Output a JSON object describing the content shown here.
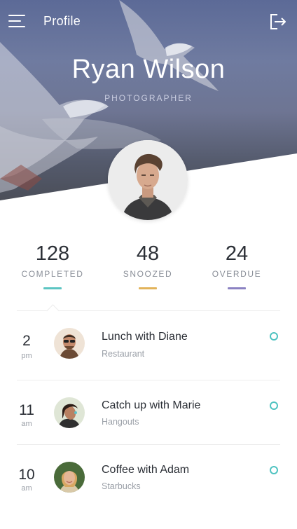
{
  "header": {
    "screen_title": "Profile",
    "icons": {
      "menu": "menu-icon",
      "logout": "logout-icon"
    }
  },
  "user": {
    "name": "Ryan Wilson",
    "role": "PHOTOGRAPHER"
  },
  "stats": [
    {
      "value": "128",
      "label": "COMPLETED",
      "color": "#5cc5c2"
    },
    {
      "value": "48",
      "label": "SNOOZED",
      "color": "#e2b35a"
    },
    {
      "value": "24",
      "label": "OVERDUE",
      "color": "#8b82c2"
    }
  ],
  "events": [
    {
      "hour": "2",
      "ampm": "pm",
      "title": "Lunch with Diane",
      "subtitle": "Restaurant"
    },
    {
      "hour": "11",
      "ampm": "am",
      "title": "Catch up with Marie",
      "subtitle": "Hangouts"
    },
    {
      "hour": "10",
      "ampm": "am",
      "title": "Coffee with Adam",
      "subtitle": "Starbucks"
    }
  ],
  "colors": {
    "accent": "#4fc3c1",
    "text": "#2b2f36",
    "muted": "#9ba0a8"
  }
}
